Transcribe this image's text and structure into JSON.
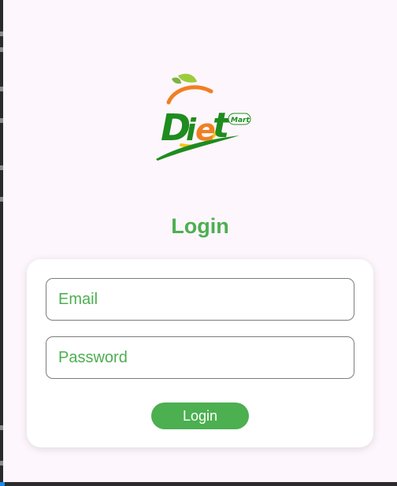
{
  "logo": {
    "brand_text": "Diet",
    "sub_text": "Mart",
    "colors": {
      "green": "#1e8c1e",
      "leaf": "#9ccc3c",
      "orange": "#f07f22",
      "yellow": "#f5c518"
    }
  },
  "login": {
    "title": "Login",
    "email_placeholder": "Email",
    "password_placeholder": "Password",
    "button_label": "Login"
  },
  "theme": {
    "accent": "#4caf50",
    "background": "#fdf6fc",
    "card": "#ffffff"
  }
}
